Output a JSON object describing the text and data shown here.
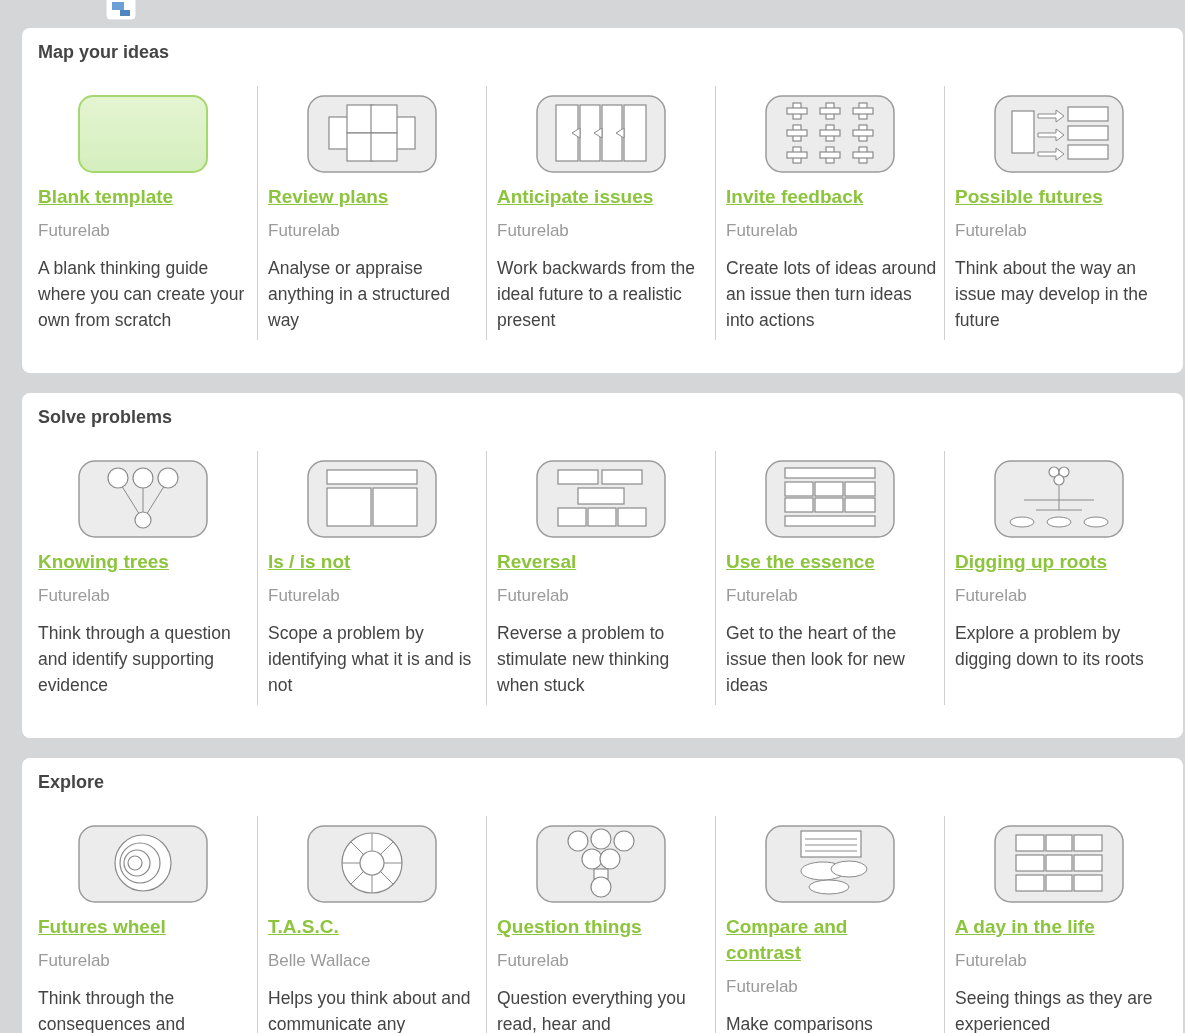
{
  "sections": [
    {
      "title": "Map your ideas",
      "items": [
        {
          "kind": "blank",
          "title": "Blank template",
          "author": "Futurelab",
          "description": "A blank thinking guide where you can create your own from scratch"
        },
        {
          "kind": "plans",
          "title": "Review plans",
          "author": "Futurelab",
          "description": "Analyse or appraise anything in a structured way"
        },
        {
          "kind": "columns",
          "title": "Anticipate issues",
          "author": "Futurelab",
          "description": "Work backwards from the ideal future to a realistic present"
        },
        {
          "kind": "crosses",
          "title": "Invite feedback",
          "author": "Futurelab",
          "description": "Create lots of ideas around an issue then turn ideas into actions"
        },
        {
          "kind": "arrows",
          "title": "Possible futures",
          "author": "Futurelab",
          "description": "Think about the way an issue may develop in the future"
        }
      ]
    },
    {
      "title": "Solve problems",
      "items": [
        {
          "kind": "tree",
          "title": "Knowing trees",
          "author": "Futurelab",
          "description": "Think through a question and identify supporting evidence"
        },
        {
          "kind": "split",
          "title": "Is / is not",
          "author": "Futurelab",
          "description": "Scope a problem by identifying what it is and is not"
        },
        {
          "kind": "bricks",
          "title": "Reversal",
          "author": "Futurelab",
          "description": "Reverse a problem to stimulate new thinking when stuck"
        },
        {
          "kind": "table",
          "title": "Use the essence",
          "author": "Futurelab",
          "description": "Get to the heart of the issue then look for new ideas"
        },
        {
          "kind": "roots",
          "title": "Digging up roots",
          "author": "Futurelab",
          "description": "Explore a problem by digging down to its roots"
        }
      ]
    },
    {
      "title": "Explore",
      "items": [
        {
          "kind": "rings",
          "title": "Futures wheel",
          "author": "Futurelab",
          "description": "Think through the consequences and"
        },
        {
          "kind": "wheel",
          "title": "T.A.S.C.",
          "author": "Belle Wallace",
          "description": "Helps you think about and communicate any"
        },
        {
          "kind": "hexes",
          "title": "Question things",
          "author": "Futurelab",
          "description": "Question everything you read, hear and"
        },
        {
          "kind": "clouds",
          "title": "Compare and contrast",
          "author": "Futurelab",
          "description": "Make comparisons"
        },
        {
          "kind": "grid",
          "title": "A day in the life",
          "author": "Futurelab",
          "description": "Seeing things as they are experienced"
        }
      ]
    }
  ]
}
